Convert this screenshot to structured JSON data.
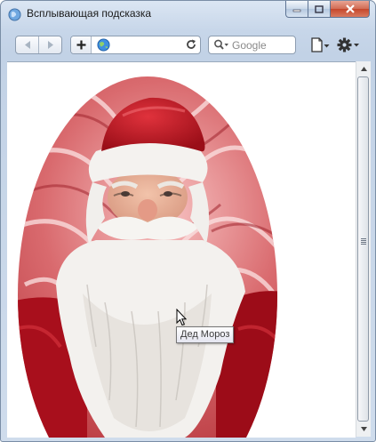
{
  "window": {
    "title": "Всплывающая подсказка"
  },
  "toolbar": {
    "url_value": "",
    "search_placeholder": "Google"
  },
  "image": {
    "tooltip": "Дед Мороз"
  },
  "colors": {
    "accent": "#c5462b",
    "frame": "#c7d6e9"
  }
}
